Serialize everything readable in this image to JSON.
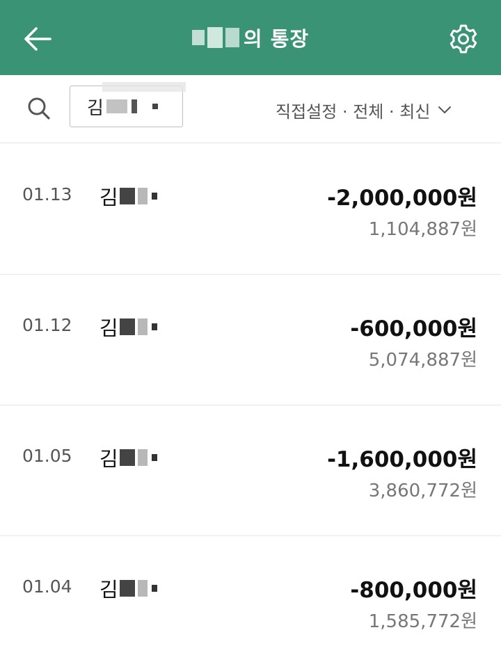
{
  "header": {
    "title_suffix": "의 통장",
    "back_icon": "arrow-left-icon",
    "settings_icon": "gear-icon",
    "bg_color": "#3a9375"
  },
  "filter": {
    "search_icon": "search-icon",
    "search_value": "김",
    "sort_label": "직접설정 · 전체 · 최신",
    "sort_icon": "chevron-down-icon"
  },
  "transactions": [
    {
      "date": "01.13",
      "name": "김",
      "amount": "-2,000,000원",
      "balance": "1,104,887원"
    },
    {
      "date": "01.12",
      "name": "김",
      "amount": "-600,000원",
      "balance": "5,074,887원"
    },
    {
      "date": "01.05",
      "name": "김",
      "amount": "-1,600,000원",
      "balance": "3,860,772원"
    },
    {
      "date": "01.04",
      "name": "김",
      "amount": "-800,000원",
      "balance": "1,585,772원"
    }
  ]
}
